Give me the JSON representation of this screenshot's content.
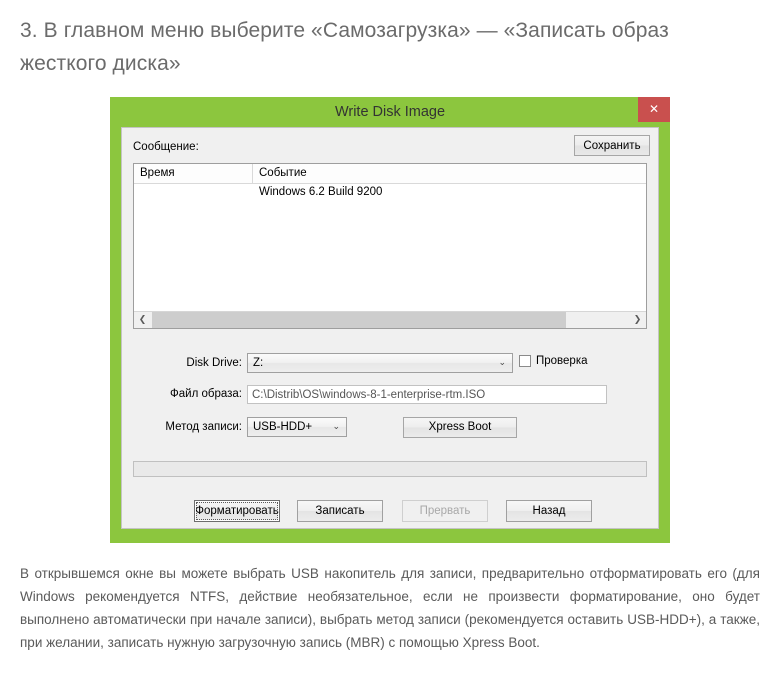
{
  "article": {
    "heading": "3. В главном меню выберите «Самозагрузка» — «Записать образ жесткого диска»",
    "paragraph": "В открывшемся окне вы можете выбрать USB накопитель для записи, предварительно отформатировать его (для Windows рекомендуется NTFS, действие необязательное, если не произвести форматирование, оно будет выполнено автоматически при начале записи), выбрать метод записи (рекомендуется оставить USB-HDD+), а также, при желании, записать нужную загрузочную запись (MBR) с помощью Xpress Boot."
  },
  "dialog": {
    "title": "Write Disk Image",
    "close_label": "✕",
    "message_label": "Сообщение:",
    "save_label": "Сохранить",
    "log": {
      "columns": [
        "Время",
        "Событие"
      ],
      "rows": [
        {
          "time": "",
          "event": "Windows 6.2 Build 9200"
        }
      ],
      "scroll_left_icon": "❮",
      "scroll_right_icon": "❯"
    },
    "fields": {
      "disk_drive_label": "Disk Drive:",
      "disk_drive_value": "Z:",
      "verify_label": "Проверка",
      "verify_checked": false,
      "image_file_label": "Файл образа:",
      "image_file_value": "C:\\Distrib\\OS\\windows-8-1-enterprise-rtm.ISO",
      "write_method_label": "Метод записи:",
      "write_method_value": "USB-HDD+",
      "xpress_boot_label": "Xpress Boot",
      "chevron_icon": "⌄"
    },
    "buttons": {
      "format": "Форматировать",
      "write": "Записать",
      "abort": "Прервать",
      "back": "Назад"
    }
  },
  "colors": {
    "frame_green": "#8cc63e",
    "close_red": "#c9504e",
    "dialog_bg": "#f0f0f0",
    "text_gray": "#5a5a5a"
  }
}
